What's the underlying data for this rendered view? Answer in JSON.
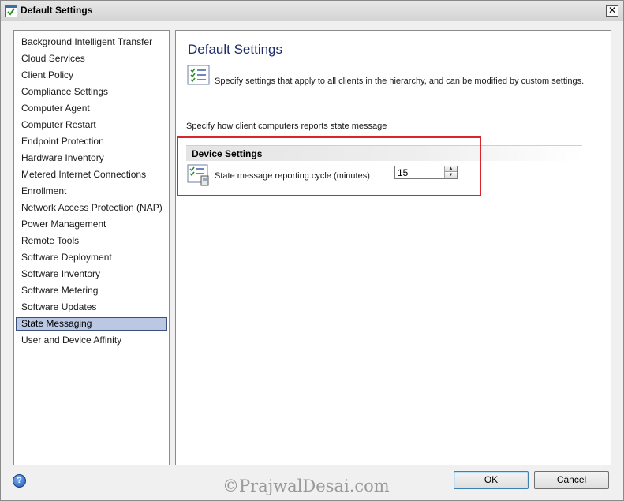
{
  "window": {
    "title": "Default Settings",
    "close_glyph": "✕"
  },
  "nav": {
    "items": [
      {
        "label": "Background Intelligent Transfer"
      },
      {
        "label": "Cloud Services"
      },
      {
        "label": "Client Policy"
      },
      {
        "label": "Compliance Settings"
      },
      {
        "label": "Computer Agent"
      },
      {
        "label": "Computer Restart"
      },
      {
        "label": "Endpoint Protection"
      },
      {
        "label": "Hardware Inventory"
      },
      {
        "label": "Metered Internet Connections"
      },
      {
        "label": "Enrollment"
      },
      {
        "label": "Network Access Protection (NAP)"
      },
      {
        "label": "Power Management"
      },
      {
        "label": "Remote Tools"
      },
      {
        "label": "Software Deployment"
      },
      {
        "label": "Software Inventory"
      },
      {
        "label": "Software Metering"
      },
      {
        "label": "Software Updates"
      },
      {
        "label": "State Messaging",
        "selected": true
      },
      {
        "label": "User and Device Affinity"
      }
    ]
  },
  "content": {
    "title": "Default Settings",
    "description": "Specify settings that apply to all clients in the hierarchy, and can be modified by custom settings.",
    "sub_description": "Specify how client computers reports state message",
    "section": {
      "title": "Device Settings",
      "setting_label": "State message reporting cycle (minutes)",
      "setting_value": "15"
    }
  },
  "footer": {
    "help_glyph": "?",
    "watermark": "©PrajwalDesai.com",
    "ok_label": "OK",
    "cancel_label": "Cancel"
  },
  "colors": {
    "highlight": "#d9252a",
    "selected_bg": "#bac8e4",
    "title_color": "#1d2a6b"
  }
}
